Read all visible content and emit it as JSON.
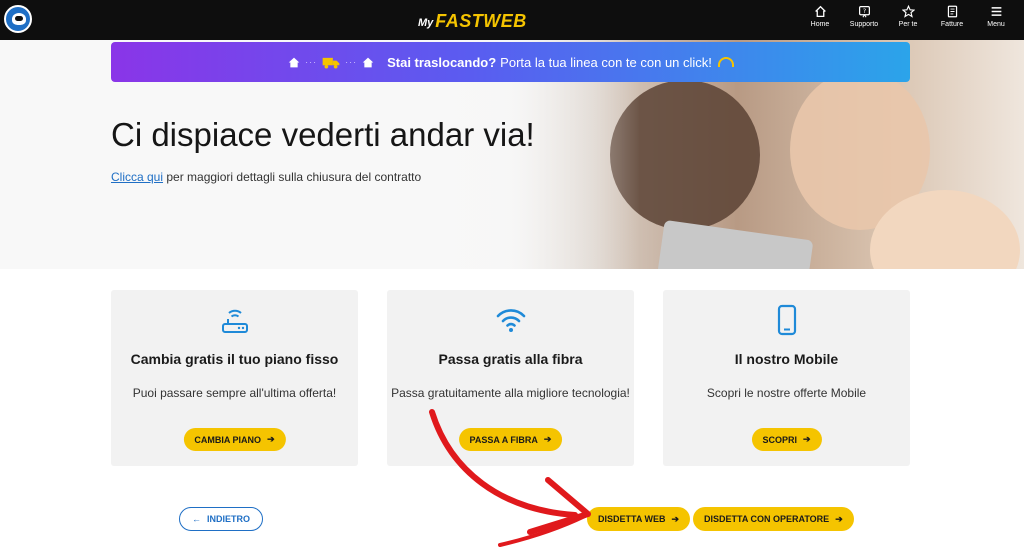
{
  "header": {
    "logo_prefix": "My",
    "logo_text": "FASTWEB",
    "nav": [
      {
        "label": "Home",
        "icon": "home-icon"
      },
      {
        "label": "Supporto",
        "icon": "support-icon"
      },
      {
        "label": "Per te",
        "icon": "star-icon"
      },
      {
        "label": "Fatture",
        "icon": "invoice-icon"
      },
      {
        "label": "Menu",
        "icon": "menu-icon"
      }
    ]
  },
  "banner": {
    "bold": "Stai traslocando?",
    "text": "Porta la tua linea con te con un click!"
  },
  "hero": {
    "title": "Ci dispiace vederti andar via!",
    "link_text": "Clicca qui",
    "subtitle_rest": " per maggiori dettagli sulla chiusura del contratto"
  },
  "cards": [
    {
      "title": "Cambia gratis il tuo piano fisso",
      "desc": "Puoi passare sempre all'ultima offerta!",
      "button": "CAMBIA PIANO",
      "icon": "router-icon"
    },
    {
      "title": "Passa gratis alla fibra",
      "desc": "Passa gratuitamente alla migliore tecnologia!",
      "button": "PASSA A FIBRA",
      "icon": "wifi-icon"
    },
    {
      "title": "Il nostro Mobile",
      "desc": "Scopri le nostre offerte Mobile",
      "button": "SCOPRI",
      "icon": "smartphone-icon"
    }
  ],
  "actions": {
    "back": "INDIETRO",
    "disdetta_web": "DISDETTA WEB",
    "disdetta_operatore": "DISDETTA CON OPERATORE"
  },
  "colors": {
    "accent_yellow": "#f5c400",
    "link_blue": "#1f6fc5",
    "topbar": "#0e0e0e",
    "annotation_red": "#e0191c"
  }
}
